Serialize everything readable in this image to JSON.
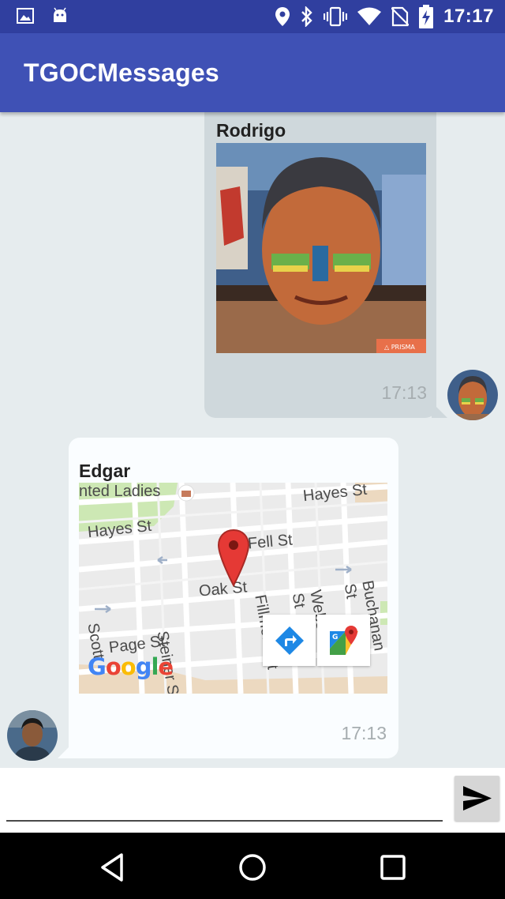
{
  "status_bar": {
    "time": "17:17",
    "icons_left": [
      "image-icon",
      "android-icon"
    ],
    "icons_right": [
      "location-icon",
      "bluetooth-icon",
      "vibrate-icon",
      "wifi-icon",
      "no-sim-icon",
      "battery-charging-icon"
    ]
  },
  "app_bar": {
    "title": "TGOCMessages"
  },
  "messages": [
    {
      "sender": "Rodrigo",
      "time": "17:13",
      "type": "image",
      "direction": "outgoing"
    },
    {
      "sender": "Edgar",
      "time": "17:13",
      "type": "location",
      "direction": "incoming",
      "map": {
        "labels": [
          "nted Ladies",
          "Hayes St",
          "Hayes St",
          "Fell St",
          "Oak St",
          "Steiner St",
          "Fillmore St",
          "Webster St",
          "Buchanan St",
          "Page St",
          "Scott"
        ],
        "logo": "Google"
      }
    }
  ],
  "composer": {
    "placeholder": "",
    "send_icon": "send-icon"
  },
  "nav_bar": {
    "icons": [
      "back-icon",
      "home-icon",
      "recents-icon"
    ]
  },
  "colors": {
    "primary": "#3f51b5",
    "primary_dark": "#303f9f",
    "outgoing_bubble": "#cfd8dc",
    "incoming_bubble": "#fafdff"
  }
}
